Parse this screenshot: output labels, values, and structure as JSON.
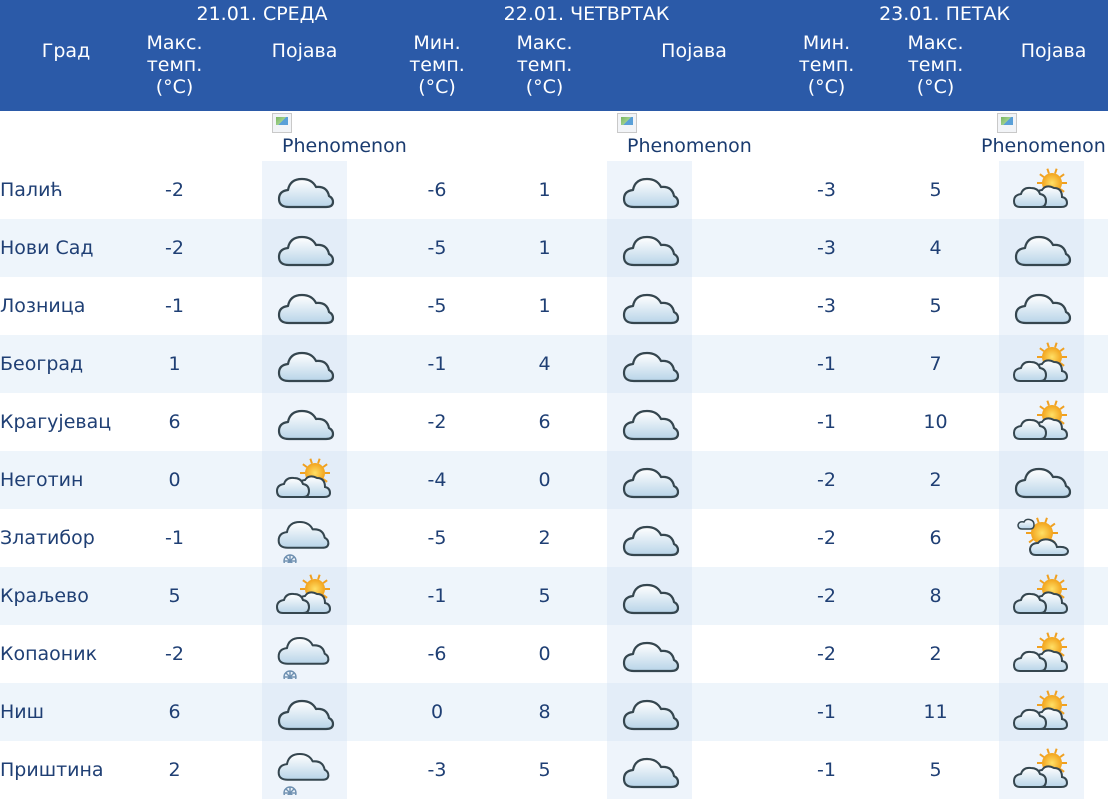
{
  "header": {
    "city_col": "Град",
    "days": [
      {
        "date": "21.01. СРЕДА",
        "max_label": "Макс.\nтемп.\n(°C)",
        "phen_label": "Појава"
      },
      {
        "date": "22.01. ЧЕТВРТАК",
        "min_label": "Мин.\nтемп.\n(°C)",
        "max_label": "Макс.\nтемп.\n(°C)",
        "phen_label": "Појава"
      },
      {
        "date": "23.01. ПЕТАК",
        "min_label": "Мин.\nтемп.\n(°C)",
        "max_label": "Макс.\nтемп.\n(°C)",
        "phen_label": "Појава"
      }
    ],
    "phenomenon_alt": "Phenomenon"
  },
  "rows": [
    {
      "city": "Палић",
      "d1_max": "-2",
      "d1_icon": "cloud-icon",
      "d2_min": "-6",
      "d2_max": "1",
      "d2_icon": "cloud-icon",
      "d3_min": "-3",
      "d3_max": "5",
      "d3_icon": "sun-cloud-icon"
    },
    {
      "city": "Нови Сад",
      "d1_max": "-2",
      "d1_icon": "cloud-icon",
      "d2_min": "-5",
      "d2_max": "1",
      "d2_icon": "cloud-icon",
      "d3_min": "-3",
      "d3_max": "4",
      "d3_icon": "cloud-icon"
    },
    {
      "city": "Лозница",
      "d1_max": "-1",
      "d1_icon": "cloud-icon",
      "d2_min": "-5",
      "d2_max": "1",
      "d2_icon": "cloud-icon",
      "d3_min": "-3",
      "d3_max": "5",
      "d3_icon": "cloud-icon"
    },
    {
      "city": "Београд",
      "d1_max": "1",
      "d1_icon": "cloud-icon",
      "d2_min": "-1",
      "d2_max": "4",
      "d2_icon": "cloud-icon",
      "d3_min": "-1",
      "d3_max": "7",
      "d3_icon": "sun-cloud-icon"
    },
    {
      "city": "Крагујевац",
      "d1_max": "6",
      "d1_icon": "cloud-icon",
      "d2_min": "-2",
      "d2_max": "6",
      "d2_icon": "cloud-icon",
      "d3_min": "-1",
      "d3_max": "10",
      "d3_icon": "sun-cloud-icon"
    },
    {
      "city": "Неготин",
      "d1_max": "0",
      "d1_icon": "sun-cloud-icon",
      "d2_min": "-4",
      "d2_max": "0",
      "d2_icon": "cloud-icon",
      "d3_min": "-2",
      "d3_max": "2",
      "d3_icon": "cloud-icon"
    },
    {
      "city": "Златибор",
      "d1_max": "-1",
      "d1_icon": "snow-cloud-icon",
      "d2_min": "-5",
      "d2_max": "2",
      "d2_icon": "cloud-icon",
      "d3_min": "-2",
      "d3_max": "6",
      "d3_icon": "partly-sunny-icon"
    },
    {
      "city": "Краљево",
      "d1_max": "5",
      "d1_icon": "sun-cloud-icon",
      "d2_min": "-1",
      "d2_max": "5",
      "d2_icon": "cloud-icon",
      "d3_min": "-2",
      "d3_max": "8",
      "d3_icon": "sun-cloud-icon"
    },
    {
      "city": "Копаоник",
      "d1_max": "-2",
      "d1_icon": "snow-cloud-icon",
      "d2_min": "-6",
      "d2_max": "0",
      "d2_icon": "cloud-icon",
      "d3_min": "-2",
      "d3_max": "2",
      "d3_icon": "sun-cloud-icon"
    },
    {
      "city": "Ниш",
      "d1_max": "6",
      "d1_icon": "cloud-icon",
      "d2_min": "0",
      "d2_max": "8",
      "d2_icon": "cloud-icon",
      "d3_min": "-1",
      "d3_max": "11",
      "d3_icon": "sun-cloud-icon"
    },
    {
      "city": "Приштина",
      "d1_max": "2",
      "d1_icon": "snow-cloud-icon",
      "d2_min": "-3",
      "d2_max": "5",
      "d2_icon": "cloud-icon",
      "d3_min": "-1",
      "d3_max": "5",
      "d3_icon": "sun-cloud-icon"
    }
  ],
  "colors": {
    "header_bg": "#2b5aa8",
    "text": "#1f3f74",
    "row_alt": "#eef5fb"
  }
}
